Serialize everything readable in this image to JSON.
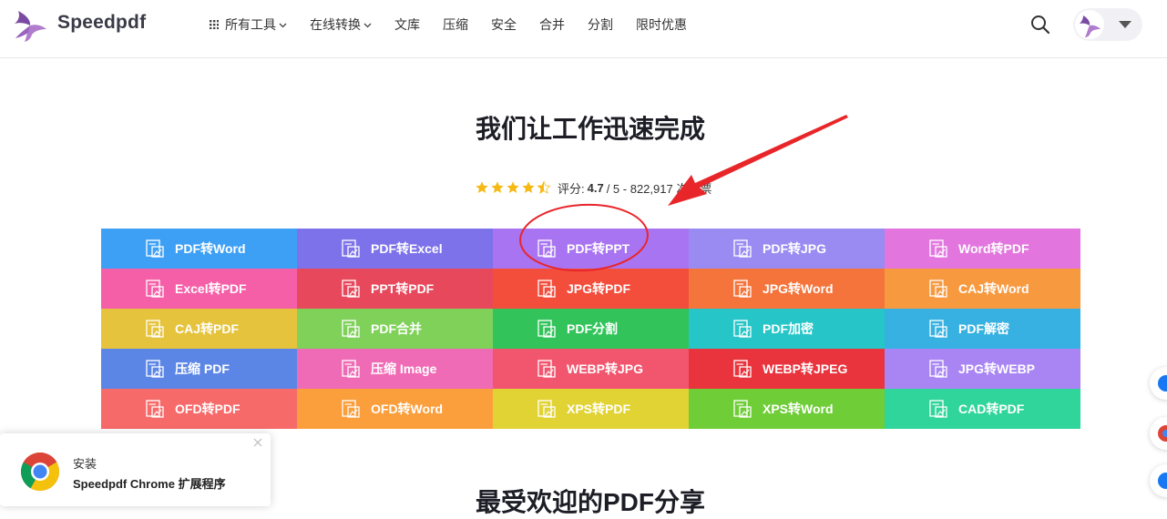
{
  "brand": {
    "name": "Speedpdf"
  },
  "nav": [
    {
      "label": "所有工具",
      "has_grid": true,
      "has_chevron": true
    },
    {
      "label": "在线转换",
      "has_grid": false,
      "has_chevron": true
    },
    {
      "label": "文库"
    },
    {
      "label": "压缩"
    },
    {
      "label": "安全"
    },
    {
      "label": "合并"
    },
    {
      "label": "分割"
    },
    {
      "label": "限时优惠"
    }
  ],
  "hero": {
    "title": "我们让工作迅速完成",
    "rating_prefix": "评分:",
    "rating_value": "4.7",
    "rating_suffix": "/ 5 - 822,917 次投票",
    "stars": 4.5
  },
  "tools": [
    {
      "label": "PDF转Word",
      "color": "#3ea0f5"
    },
    {
      "label": "PDF转Excel",
      "color": "#7d72ea"
    },
    {
      "label": "PDF转PPT",
      "color": "#a974f1"
    },
    {
      "label": "PDF转JPG",
      "color": "#9a8bf2"
    },
    {
      "label": "Word转PDF",
      "color": "#e276de"
    },
    {
      "label": "Excel转PDF",
      "color": "#f55fa8"
    },
    {
      "label": "PPT转PDF",
      "color": "#e8485c"
    },
    {
      "label": "JPG转PDF",
      "color": "#f34d3c"
    },
    {
      "label": "JPG转Word",
      "color": "#f4743b"
    },
    {
      "label": "CAJ转Word",
      "color": "#f7993f"
    },
    {
      "label": "CAJ转PDF",
      "color": "#e6c33c"
    },
    {
      "label": "PDF合并",
      "color": "#7fd15a"
    },
    {
      "label": "PDF分割",
      "color": "#32c45a"
    },
    {
      "label": "PDF加密",
      "color": "#26c5c7"
    },
    {
      "label": "PDF解密",
      "color": "#36b1e1"
    },
    {
      "label": "压缩 PDF",
      "color": "#5c86e6"
    },
    {
      "label": "压缩 Image",
      "color": "#f06bb5"
    },
    {
      "label": "WEBP转JPG",
      "color": "#f1566e"
    },
    {
      "label": "WEBP转JPEG",
      "color": "#e9333d"
    },
    {
      "label": "JPG转WEBP",
      "color": "#a985f4"
    },
    {
      "label": "OFD转PDF",
      "color": "#f76a6a"
    },
    {
      "label": "OFD转Word",
      "color": "#fb9e3c"
    },
    {
      "label": "XPS转PDF",
      "color": "#e2d335"
    },
    {
      "label": "XPS转Word",
      "color": "#6fcd38"
    },
    {
      "label": "CAD转PDF",
      "color": "#2fd59b"
    }
  ],
  "popup": {
    "title": "安装",
    "subtitle": "Speedpdf Chrome 扩展程序"
  },
  "section": {
    "title": "最受欢迎的PDF分享"
  },
  "colors": {
    "accent": "#8e4bbf",
    "annotation": "#e8262a"
  }
}
